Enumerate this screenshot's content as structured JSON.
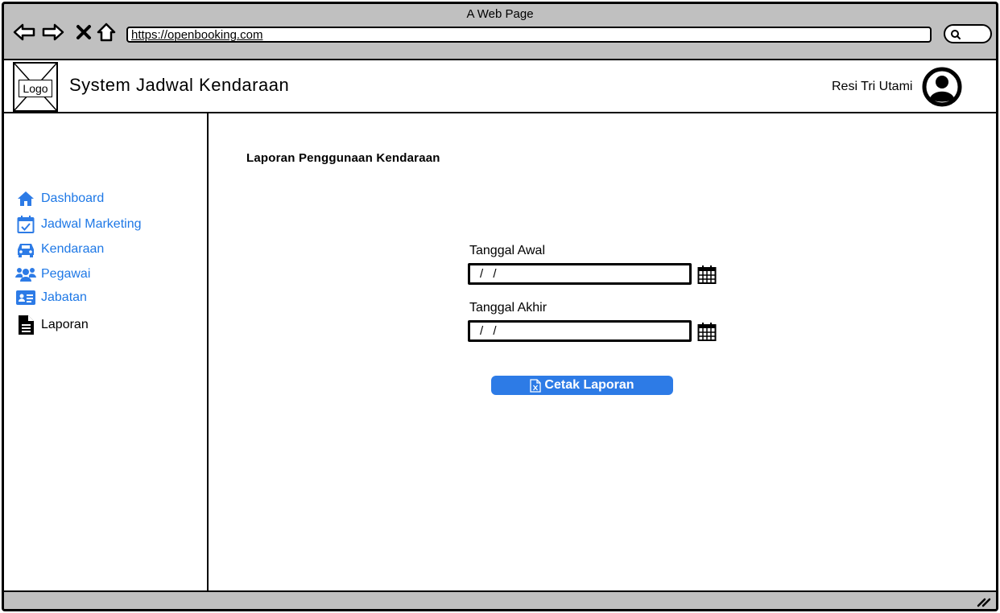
{
  "window": {
    "title": "A Web Page",
    "url": "https://openbooking.com"
  },
  "header": {
    "logo_label": "Logo",
    "app_title": "System Jadwal Kendaraan",
    "user_name": "Resi Tri Utami"
  },
  "sidebar": {
    "items": [
      {
        "label": "Dashboard",
        "icon": "home-icon"
      },
      {
        "label": "Jadwal Marketing",
        "icon": "calendar-check-icon"
      },
      {
        "label": "Kendaraan",
        "icon": "car-icon"
      },
      {
        "label": "Pegawai",
        "icon": "users-icon"
      },
      {
        "label": "Jabatan",
        "icon": "id-card-icon"
      },
      {
        "label": "Laporan",
        "icon": "document-icon"
      }
    ],
    "active_item": "Laporan"
  },
  "main": {
    "title": "Laporan Penggunaan Kendaraan",
    "start_date": {
      "label": "Tanggal Awal",
      "value": "/ /"
    },
    "end_date": {
      "label": "Tanggal Akhir",
      "value": "/ /"
    },
    "print_button": "Cetak Laporan"
  },
  "colors": {
    "link": "#1e78e6",
    "button": "#2d7be6",
    "chrome": "#c0c0c0"
  }
}
